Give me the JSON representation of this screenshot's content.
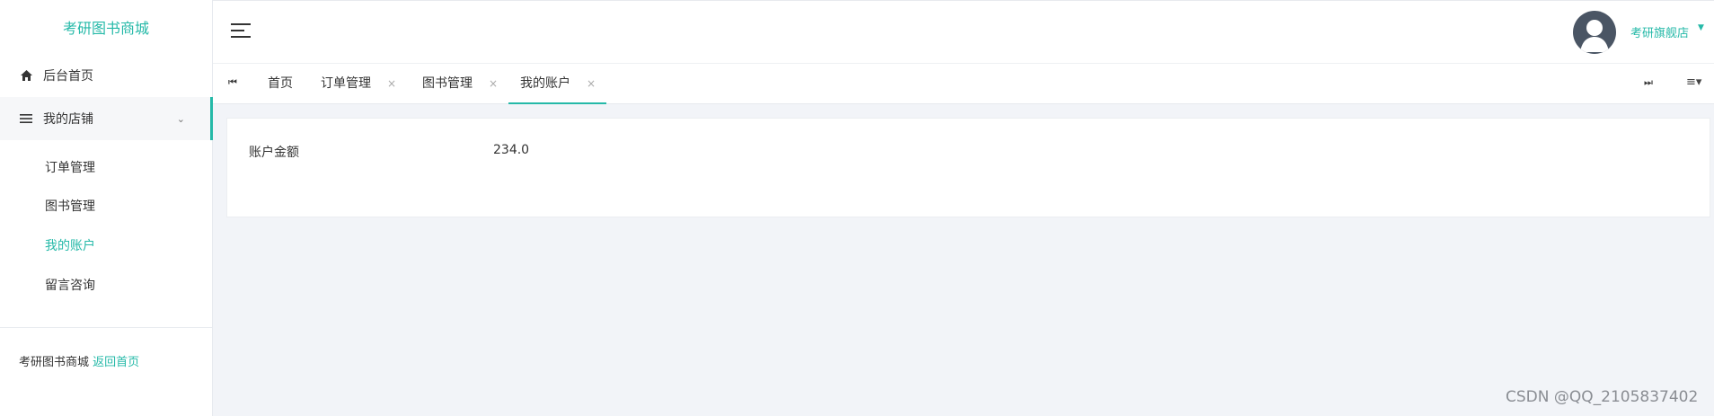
{
  "sidebar": {
    "brand": "考研图书商城",
    "items": [
      {
        "label": "后台首页",
        "icon": "home-icon"
      },
      {
        "label": "我的店铺",
        "icon": "list-icon",
        "expanded": true
      }
    ],
    "subitems": [
      {
        "label": "订单管理"
      },
      {
        "label": "图书管理"
      },
      {
        "label": "我的账户",
        "current": true
      },
      {
        "label": "留言咨询"
      }
    ],
    "footer": {
      "site": "考研图书商城",
      "link": "返回首页"
    }
  },
  "header": {
    "user_name": "考研旗舰店",
    "icons": [
      "hamburger-icon",
      "avatar-icon",
      "caret-down-icon"
    ]
  },
  "tabs": {
    "items": [
      {
        "label": "首页",
        "closable": false
      },
      {
        "label": "订单管理",
        "closable": true
      },
      {
        "label": "图书管理",
        "closable": true
      },
      {
        "label": "我的账户",
        "closable": true,
        "active": true
      }
    ],
    "close_glyph": "×",
    "nav_prev_glyph": "⏮",
    "nav_next_glyph": "⏭",
    "menu_glyph": "≡▾"
  },
  "account": {
    "balance_label": "账户金额",
    "balance_value": "234.0"
  },
  "watermark": "CSDN @QQ_2105837402",
  "colors": {
    "accent": "#25b9a8",
    "avatar_bg": "#4a5564",
    "content_bg": "#f2f4f8"
  }
}
